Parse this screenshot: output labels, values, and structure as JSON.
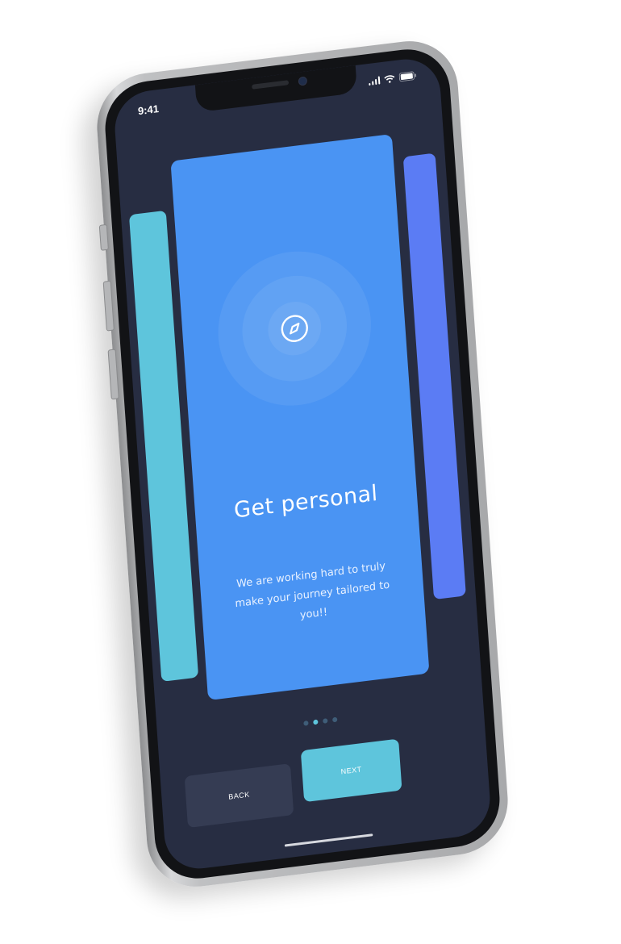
{
  "status_bar": {
    "time": "9:41",
    "signal_icon": "cellular-signal-icon",
    "wifi_icon": "wifi-icon",
    "battery_icon": "battery-icon"
  },
  "carousel": {
    "card": {
      "icon": "compass-icon",
      "title": "Get personal",
      "body": "We are working hard to truly make your journey tailored to you!!"
    },
    "pagination": {
      "total": 4,
      "active_index": 1
    }
  },
  "buttons": {
    "back_label": "BACK",
    "next_label": "NEXT"
  },
  "colors": {
    "screen_bg": "#272d42",
    "card_main": "#4a94f3",
    "card_left": "#5ec5dc",
    "card_right": "#5b7cf4",
    "next_button": "#5ec5dc",
    "back_button": "#353c53"
  }
}
